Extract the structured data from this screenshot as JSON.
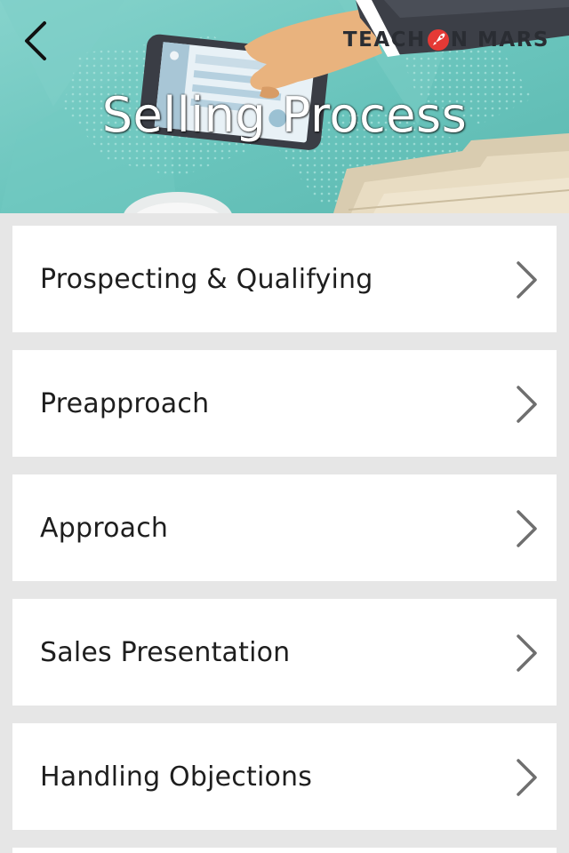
{
  "header": {
    "title": "Selling Process",
    "brand_left": "TEACH",
    "brand_right": "N MARS",
    "back_icon": "chevron-left-icon",
    "brand_accent": "#e53935"
  },
  "list": {
    "items": [
      {
        "label": "Prospecting & Qualifying",
        "icon": "chevron-right-icon"
      },
      {
        "label": "Preapproach",
        "icon": "chevron-right-icon"
      },
      {
        "label": "Approach",
        "icon": "chevron-right-icon"
      },
      {
        "label": "Sales Presentation",
        "icon": "chevron-right-icon"
      },
      {
        "label": "Handling Objections",
        "icon": "chevron-right-icon"
      }
    ]
  },
  "colors": {
    "background": "#e6e6e6",
    "card": "#ffffff",
    "text": "#1e1e1e",
    "chevron": "#6f6f6f",
    "header_teal": "#6ac5bd"
  }
}
